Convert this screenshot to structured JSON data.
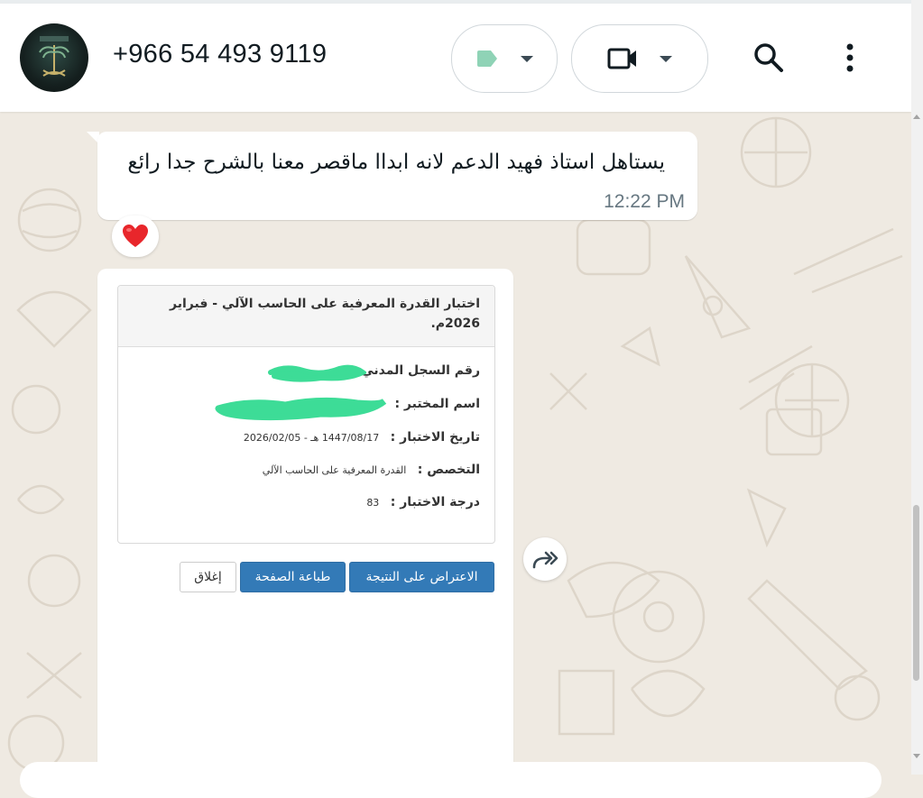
{
  "header": {
    "contact_name": "+966 54 493 9119",
    "avatar_icon": "avatar",
    "label_icon": "label-tag-icon",
    "label_color": "#8fd3b6",
    "video_icon": "video-camera-icon",
    "search_icon": "search-icon",
    "menu_icon": "more-vertical-icon"
  },
  "messages": [
    {
      "text": "يستاهل استاذ فهيد الدعم لانه ابداا ماقصر معنا بالشرح جدا رائع",
      "time": "12:22 PM",
      "reaction": "❤️"
    }
  ],
  "result_card": {
    "title": "اختبار القدرة المعرفية على الحاسب الآلي - فبراير 2026م.",
    "rows": [
      {
        "label": "رقم السجل المدني :",
        "value": ""
      },
      {
        "label": "اسم المختبر :",
        "value": ""
      },
      {
        "label": "تاريخ الاختبار :",
        "value": "1447/08/17 هـ - 2026/02/05"
      },
      {
        "label": "التخصص :",
        "value": "القدرة المعرفية على الحاسب الآلي"
      },
      {
        "label": "درجة الاختبار :",
        "value": "83"
      }
    ],
    "buttons": {
      "objection": "الاعتراض على النتيجة",
      "print": "طباعة الصفحة",
      "close": "إغلاق"
    }
  },
  "colors": {
    "chat_background": "#efeae2",
    "primary_button": "#337ab7",
    "redaction": "#3ddc97"
  }
}
